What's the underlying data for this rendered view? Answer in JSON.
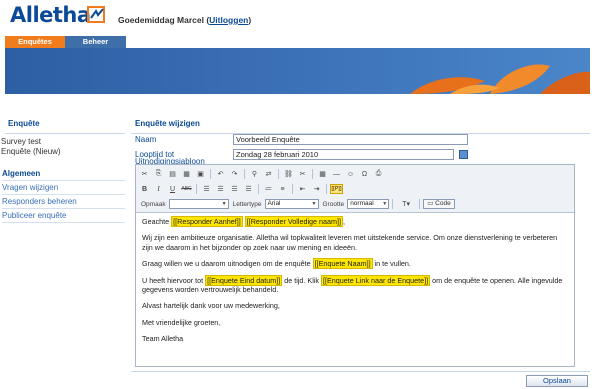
{
  "header": {
    "logo_text": "Alletha",
    "greeting": "Goedemiddag Marcel (",
    "logout_link": "Uitloggen",
    "greeting_end": ")"
  },
  "tabs": [
    {
      "label": "Enquêtes"
    },
    {
      "label": "Beheer"
    }
  ],
  "sidebar": {
    "title": "Enquête",
    "survey_name": "Survey test",
    "survey_sub": "Enquête (Nieuw)",
    "items": [
      {
        "label": "Algemeen"
      },
      {
        "label": "Vragen wijzigen"
      },
      {
        "label": "Responders beheren"
      },
      {
        "label": "Publiceer enquête"
      }
    ]
  },
  "main": {
    "title": "Enquête wijzigen",
    "fields": {
      "name_label": "Naam",
      "name_value": "Voorbeeld Enquête",
      "runtime_label": "Looptijd tot",
      "runtime_value": "Zondag 28 februari 2010",
      "template_label": "Uitnodigingsjabloon"
    }
  },
  "toolbar": {
    "format_label": "Opmaak",
    "format_value": "",
    "font_label": "Lettertype",
    "font_value": "Arial",
    "size_label": "Grootte",
    "size_value": "normaal",
    "code_label": "Code",
    "pp_label": "[[P]]"
  },
  "editor": {
    "l1_pre": "Geachte ",
    "l1_tag1": "[[Responder Aanhef]]",
    "l1_tag2": "[[Responder Volledige naam]]",
    "l1_post": ",",
    "p2": "Wij zijn een ambitieuze organisatie. Alletha wil topkwaliteit leveren met uitstekende service. Om onze dienstverlening te verbeteren zijn we daarom in het bijzonder op zoek naar uw mening en ideeën.",
    "p3_pre": "Graag willen we u daarom uitnodigen om de enquête ",
    "p3_tag": "[[Enquete Naam]]",
    "p3_post": " in te vullen.",
    "p4_a": "U heeft hiervoor tot ",
    "p4_tag1": "[[Enquete Eind datum]]",
    "p4_b": " de tijd. Klik ",
    "p4_tag2": "[[Enquete Link naar de Enquete]]",
    "p4_c": " om de enquête te openen. Alle ingevulde gegevens worden vertrouwelijk behandeld.",
    "p5": "Alvast hartelijk dank voor uw medewerking,",
    "p6": "Met vriendelijke groeten,",
    "p7": "Team Alletha"
  },
  "actions": {
    "save_label": "Opslaan"
  },
  "colors": {
    "brand_blue": "#0b4a96",
    "tab_orange": "#f07c1d",
    "tag_yellow": "#ffe600"
  }
}
